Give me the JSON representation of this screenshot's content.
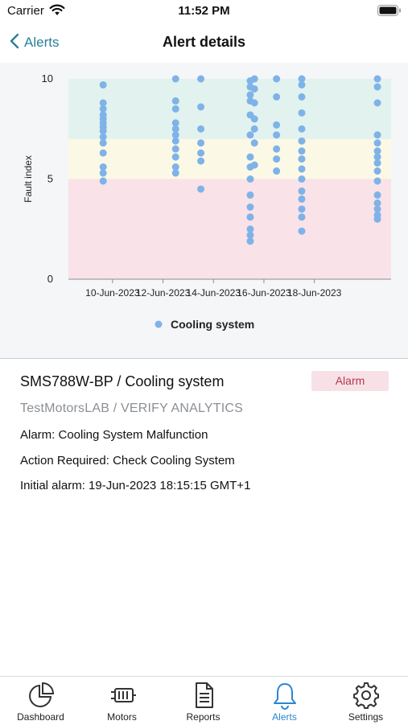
{
  "status_bar": {
    "carrier": "Carrier",
    "time": "11:52 PM"
  },
  "nav": {
    "back_label": "Alerts",
    "title": "Alert details"
  },
  "colors": {
    "accent": "#2a86d3",
    "point": "#7fb3e8",
    "band_ok": "#e2f2ef",
    "band_warn": "#fbf8e6",
    "band_alarm": "#f9e2e8"
  },
  "chart_data": {
    "type": "scatter",
    "ylabel": "Fault index",
    "yticks": [
      0,
      5,
      10
    ],
    "ylim": [
      0,
      10
    ],
    "x_tick_labels": [
      "10-Jun-2023",
      "12-Jun-2023",
      "14-Jun-2023",
      "16-Jun-2023",
      "18-Jun-2023"
    ],
    "bands": [
      {
        "name": "alarm",
        "from": 0,
        "to": 5
      },
      {
        "name": "warning",
        "from": 5,
        "to": 7
      },
      {
        "name": "ok",
        "from": 7,
        "to": 10
      }
    ],
    "legend": {
      "position": "bottom",
      "label": "Cooling system"
    },
    "series": [
      {
        "name": "Cooling system",
        "points": [
          [
            "2023-06-09",
            9.7
          ],
          [
            "2023-06-09",
            8.8
          ],
          [
            "2023-06-09",
            8.5
          ],
          [
            "2023-06-09",
            8.2
          ],
          [
            "2023-06-09",
            8.0
          ],
          [
            "2023-06-09",
            7.8
          ],
          [
            "2023-06-09",
            7.6
          ],
          [
            "2023-06-09",
            7.4
          ],
          [
            "2023-06-09",
            7.1
          ],
          [
            "2023-06-09",
            6.8
          ],
          [
            "2023-06-09",
            6.3
          ],
          [
            "2023-06-09",
            5.6
          ],
          [
            "2023-06-09",
            5.3
          ],
          [
            "2023-06-09",
            4.9
          ],
          [
            "2023-06-12",
            10.0
          ],
          [
            "2023-06-12",
            8.9
          ],
          [
            "2023-06-12",
            8.5
          ],
          [
            "2023-06-12",
            7.8
          ],
          [
            "2023-06-12",
            7.5
          ],
          [
            "2023-06-12",
            7.2
          ],
          [
            "2023-06-12",
            6.9
          ],
          [
            "2023-06-12",
            6.5
          ],
          [
            "2023-06-12",
            6.1
          ],
          [
            "2023-06-12",
            5.6
          ],
          [
            "2023-06-12",
            5.3
          ],
          [
            "2023-06-13",
            10.0
          ],
          [
            "2023-06-13",
            8.6
          ],
          [
            "2023-06-13",
            7.5
          ],
          [
            "2023-06-13",
            6.8
          ],
          [
            "2023-06-13",
            6.3
          ],
          [
            "2023-06-13",
            5.9
          ],
          [
            "2023-06-13",
            4.5
          ],
          [
            "2023-06-15",
            9.9
          ],
          [
            "2023-06-15",
            9.6
          ],
          [
            "2023-06-15",
            9.2
          ],
          [
            "2023-06-15",
            8.9
          ],
          [
            "2023-06-15",
            8.2
          ],
          [
            "2023-06-15",
            7.2
          ],
          [
            "2023-06-15",
            6.1
          ],
          [
            "2023-06-15",
            5.6
          ],
          [
            "2023-06-15",
            5.0
          ],
          [
            "2023-06-15",
            4.2
          ],
          [
            "2023-06-15",
            3.6
          ],
          [
            "2023-06-15",
            3.1
          ],
          [
            "2023-06-15",
            2.5
          ],
          [
            "2023-06-15",
            2.2
          ],
          [
            "2023-06-15",
            1.9
          ],
          [
            "2023-06-15",
            10.0
          ],
          [
            "2023-06-15",
            9.5
          ],
          [
            "2023-06-15",
            8.8
          ],
          [
            "2023-06-15",
            8.0
          ],
          [
            "2023-06-15",
            7.5
          ],
          [
            "2023-06-15",
            6.8
          ],
          [
            "2023-06-15",
            5.7
          ],
          [
            "2023-06-16",
            10.0
          ],
          [
            "2023-06-16",
            9.1
          ],
          [
            "2023-06-16",
            7.7
          ],
          [
            "2023-06-16",
            7.2
          ],
          [
            "2023-06-16",
            6.5
          ],
          [
            "2023-06-16",
            6.0
          ],
          [
            "2023-06-16",
            5.4
          ],
          [
            "2023-06-17",
            10.0
          ],
          [
            "2023-06-17",
            9.7
          ],
          [
            "2023-06-17",
            9.1
          ],
          [
            "2023-06-17",
            8.3
          ],
          [
            "2023-06-17",
            7.5
          ],
          [
            "2023-06-17",
            6.9
          ],
          [
            "2023-06-17",
            6.4
          ],
          [
            "2023-06-17",
            6.0
          ],
          [
            "2023-06-17",
            5.5
          ],
          [
            "2023-06-17",
            5.0
          ],
          [
            "2023-06-17",
            4.4
          ],
          [
            "2023-06-17",
            4.0
          ],
          [
            "2023-06-17",
            3.5
          ],
          [
            "2023-06-17",
            3.1
          ],
          [
            "2023-06-17",
            2.4
          ],
          [
            "2023-06-20",
            10.0
          ],
          [
            "2023-06-20",
            9.6
          ],
          [
            "2023-06-20",
            8.8
          ],
          [
            "2023-06-20",
            7.2
          ],
          [
            "2023-06-20",
            6.8
          ],
          [
            "2023-06-20",
            6.4
          ],
          [
            "2023-06-20",
            6.1
          ],
          [
            "2023-06-20",
            5.8
          ],
          [
            "2023-06-20",
            5.4
          ],
          [
            "2023-06-20",
            4.9
          ],
          [
            "2023-06-20",
            4.2
          ],
          [
            "2023-06-20",
            3.8
          ],
          [
            "2023-06-20",
            3.5
          ],
          [
            "2023-06-20",
            3.2
          ],
          [
            "2023-06-20",
            3.0
          ]
        ]
      }
    ]
  },
  "detail": {
    "device_title": "SMS788W-BP / Cooling system",
    "badge": "Alarm",
    "subtitle": "TestMotorsLAB / VERIFY ANALYTICS",
    "alarm_line": "Alarm: Cooling System Malfunction",
    "action_line": "Action Required: Check Cooling System",
    "initial_line": "Initial alarm: 19-Jun-2023 18:15:15 GMT+1"
  },
  "tabs": [
    {
      "label": "Dashboard",
      "icon": "pie-chart-icon",
      "active": false
    },
    {
      "label": "Motors",
      "icon": "motor-icon",
      "active": false
    },
    {
      "label": "Reports",
      "icon": "document-icon",
      "active": false
    },
    {
      "label": "Alerts",
      "icon": "bell-icon",
      "active": true
    },
    {
      "label": "Settings",
      "icon": "gear-icon",
      "active": false
    }
  ]
}
